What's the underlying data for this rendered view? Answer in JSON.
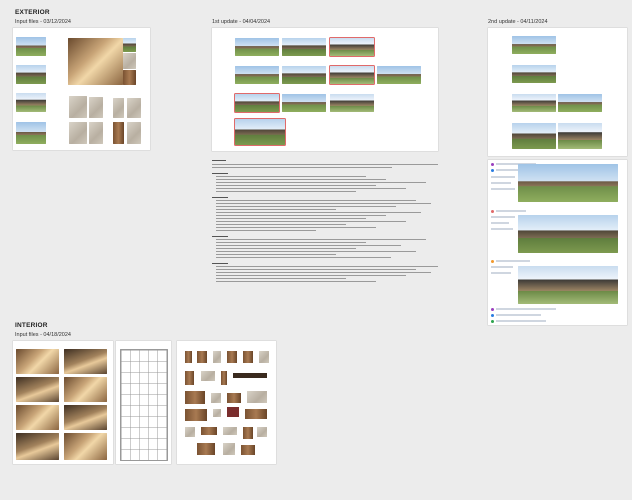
{
  "sections": {
    "exterior": {
      "title": "EXTERIOR",
      "input_files": "Input files - 03/12/2024",
      "update1": "1st update - 04/04/2024",
      "update2": "2nd update - 04/11/2024"
    },
    "interior": {
      "title": "INTERIOR",
      "input_files": "Input files - 04/18/2024"
    }
  },
  "colors": {
    "canvas": "#ececec",
    "board": "#ffffff",
    "markup": "#e06a6a",
    "link": "#2a5db0"
  }
}
